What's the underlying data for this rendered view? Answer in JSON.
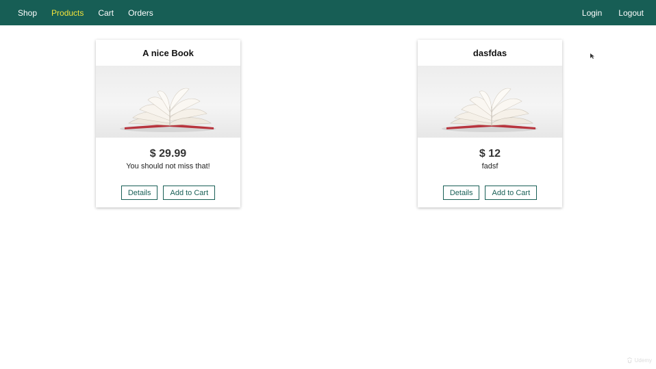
{
  "nav": {
    "left": [
      {
        "label": "Shop",
        "active": false
      },
      {
        "label": "Products",
        "active": true
      },
      {
        "label": "Cart",
        "active": false
      },
      {
        "label": "Orders",
        "active": false
      }
    ],
    "right": [
      {
        "label": "Login"
      },
      {
        "label": "Logout"
      }
    ]
  },
  "products": [
    {
      "title": "A nice Book",
      "price": "$ 29.99",
      "description": "You should not miss that!",
      "details_label": "Details",
      "add_to_cart_label": "Add to Cart",
      "image_icon": "open-book-image"
    },
    {
      "title": "dasfdas",
      "price": "$ 12",
      "description": "fadsf",
      "details_label": "Details",
      "add_to_cart_label": "Add to Cart",
      "image_icon": "open-book-image"
    }
  ],
  "watermark": {
    "text": "Udemy",
    "icon": "udemy-logo-icon"
  },
  "colors": {
    "nav_bg": "#175e55",
    "nav_active": "#f3e33b",
    "button_border": "#175e55"
  }
}
